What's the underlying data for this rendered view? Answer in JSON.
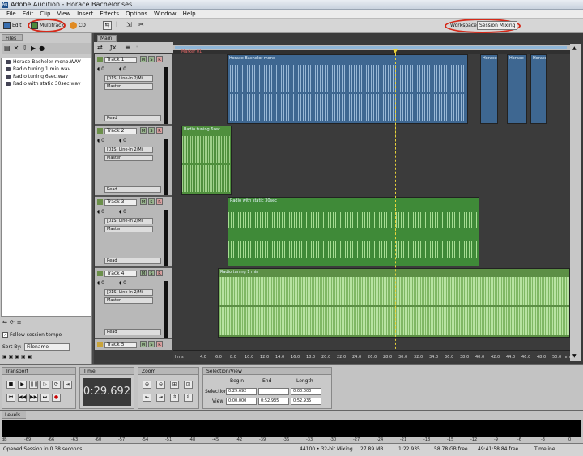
{
  "window": {
    "title": "Adobe Audition - Horace Bachelor.ses"
  },
  "menu": [
    "File",
    "Edit",
    "Clip",
    "View",
    "Insert",
    "Effects",
    "Options",
    "Window",
    "Help"
  ],
  "toolbar": {
    "edit": "Edit",
    "multitrack": "Multitrack",
    "cd": "CD",
    "workspace_label": "Workspace:",
    "workspace_value": "Session Mixing"
  },
  "files": {
    "tab": "Files",
    "items": [
      "Horace Bachelor mono.WAV",
      "Radio tuning 1 min.wav",
      "Radio tuning 6sec.wav",
      "Radio with static 30sec.wav"
    ],
    "follow_tempo": "Follow session tempo",
    "sort_label": "Sort By:",
    "sort_value": "Filename"
  },
  "main": {
    "tab": "Main",
    "marker": "Marker 01"
  },
  "tracks": [
    {
      "name": "Track 1",
      "input": "[01S] Line-In 2/Mi",
      "output": "Master",
      "mode": "Read",
      "clips": [
        "Horace Bachelor mono",
        "Horace",
        "Horace",
        "Horace"
      ]
    },
    {
      "name": "Track 2",
      "input": "[01S] Line-In 2/Mi",
      "output": "Master",
      "mode": "Read",
      "clips": [
        "Radio tuning 6sec"
      ]
    },
    {
      "name": "Track 3",
      "input": "[01S] Line-In 2/Mi",
      "output": "Master",
      "mode": "Read",
      "clips": [
        "Radio with static 30sec"
      ]
    },
    {
      "name": "Track 4",
      "input": "[01S] Line-In 2/Mi",
      "output": "Master",
      "mode": "Read",
      "clips": [
        "Radio tuning 1 min"
      ]
    },
    {
      "name": "Track 5"
    }
  ],
  "ruler": [
    "hms",
    "4.0",
    "6.0",
    "8.0",
    "10.0",
    "12.0",
    "14.0",
    "16.0",
    "18.0",
    "20.0",
    "22.0",
    "24.0",
    "26.0",
    "28.0",
    "30.0",
    "32.0",
    "34.0",
    "36.0",
    "38.0",
    "40.0",
    "42.0",
    "44.0",
    "46.0",
    "48.0",
    "50.0",
    "hms"
  ],
  "transport": {
    "tab": "Transport"
  },
  "time": {
    "tab": "Time",
    "value": "0:29.692"
  },
  "zoom": {
    "tab": "Zoom"
  },
  "selection": {
    "tab": "Selection/View",
    "begin": "Begin",
    "end": "End",
    "length": "Length",
    "sel_label": "Selection",
    "view_label": "View",
    "sel_begin": "0:29.692",
    "sel_end": "",
    "sel_length": "0:00.000",
    "view_begin": "0:00.000",
    "view_end": "0:52.935",
    "view_length": "0:52.935"
  },
  "levels": {
    "tab": "Levels",
    "scale": [
      "dB",
      "-69",
      "-66",
      "-63",
      "-60",
      "-57",
      "-54",
      "-51",
      "-48",
      "-45",
      "-42",
      "-39",
      "-36",
      "-33",
      "-30",
      "-27",
      "-24",
      "-21",
      "-18",
      "-15",
      "-12",
      "-9",
      "-6",
      "-3",
      "0"
    ]
  },
  "status": {
    "msg": "Opened Session in 0.38 seconds",
    "format": "44100 • 32-bit Mixing",
    "size": "27.89 MB",
    "len": "1:22.935",
    "free": "58.78 GB free",
    "time": "49:41:58.84 free",
    "mode": "Timeline"
  }
}
